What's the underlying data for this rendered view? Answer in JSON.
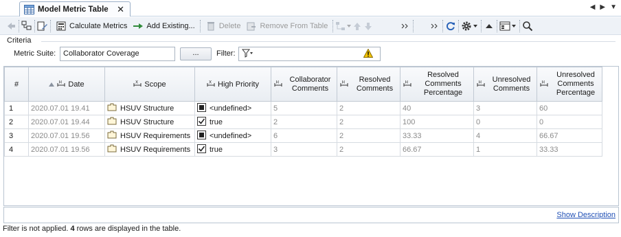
{
  "tab": {
    "title": "Model Metric Table",
    "close": "✕"
  },
  "tabnav": {
    "left": "◀",
    "right": "▶",
    "menu": "▼"
  },
  "toolbar": {
    "calculate_label": "Calculate Metrics",
    "add_existing_label": "Add Existing...",
    "delete_label": "Delete",
    "remove_label": "Remove From Table"
  },
  "criteria": {
    "title": "Criteria",
    "metric_suite_label": "Metric Suite:",
    "metric_suite_value": "Collaborator Coverage",
    "dots_label": "...",
    "filter_label": "Filter:"
  },
  "table": {
    "columns": {
      "num": "#",
      "date": "Date",
      "scope": "Scope",
      "high_priority": "High Priority",
      "collab_comments_1": "Collaborator",
      "collab_comments_2": "Comments",
      "resolved_1": "Resolved",
      "resolved_2": "Comments",
      "resolved_pct_1": "Resolved",
      "resolved_pct_2": "Comments",
      "resolved_pct_3": "Percentage",
      "unresolved_1": "Unresolved",
      "unresolved_2": "Comments",
      "unresolved_pct_1": "Unresolved",
      "unresolved_pct_2": "Comments",
      "unresolved_pct_3": "Percentage"
    },
    "rows": [
      {
        "num": "1",
        "date": "2020.07.01 19.41",
        "scope": "HSUV Structure",
        "priority": "<undefined>",
        "collab": "5",
        "resolved": "2",
        "resolved_pct": "40",
        "unresolved": "3",
        "unresolved_pct": "60"
      },
      {
        "num": "2",
        "date": "2020.07.01 19.44",
        "scope": "HSUV Structure",
        "priority": "true",
        "collab": "2",
        "resolved": "2",
        "resolved_pct": "100",
        "unresolved": "0",
        "unresolved_pct": "0"
      },
      {
        "num": "3",
        "date": "2020.07.01 19.56",
        "scope": "HSUV Requirements",
        "priority": "<undefined>",
        "collab": "6",
        "resolved": "2",
        "resolved_pct": "33.33",
        "unresolved": "4",
        "unresolved_pct": "66.67"
      },
      {
        "num": "4",
        "date": "2020.07.01 19.56",
        "scope": "HSUV Requirements",
        "priority": "true",
        "collab": "3",
        "resolved": "2",
        "resolved_pct": "66.67",
        "unresolved": "1",
        "unresolved_pct": "33.33"
      }
    ]
  },
  "description": {
    "link": "Show Description"
  },
  "status": {
    "prefix": "Filter is not applied.",
    "count": "4",
    "suffix": "rows are displayed in the table."
  },
  "colors": {
    "accent": "#1f4fb5",
    "toolbar_bg": "#eef2f7",
    "header_bg": "#e9edf2",
    "warning": "#f3c400"
  }
}
